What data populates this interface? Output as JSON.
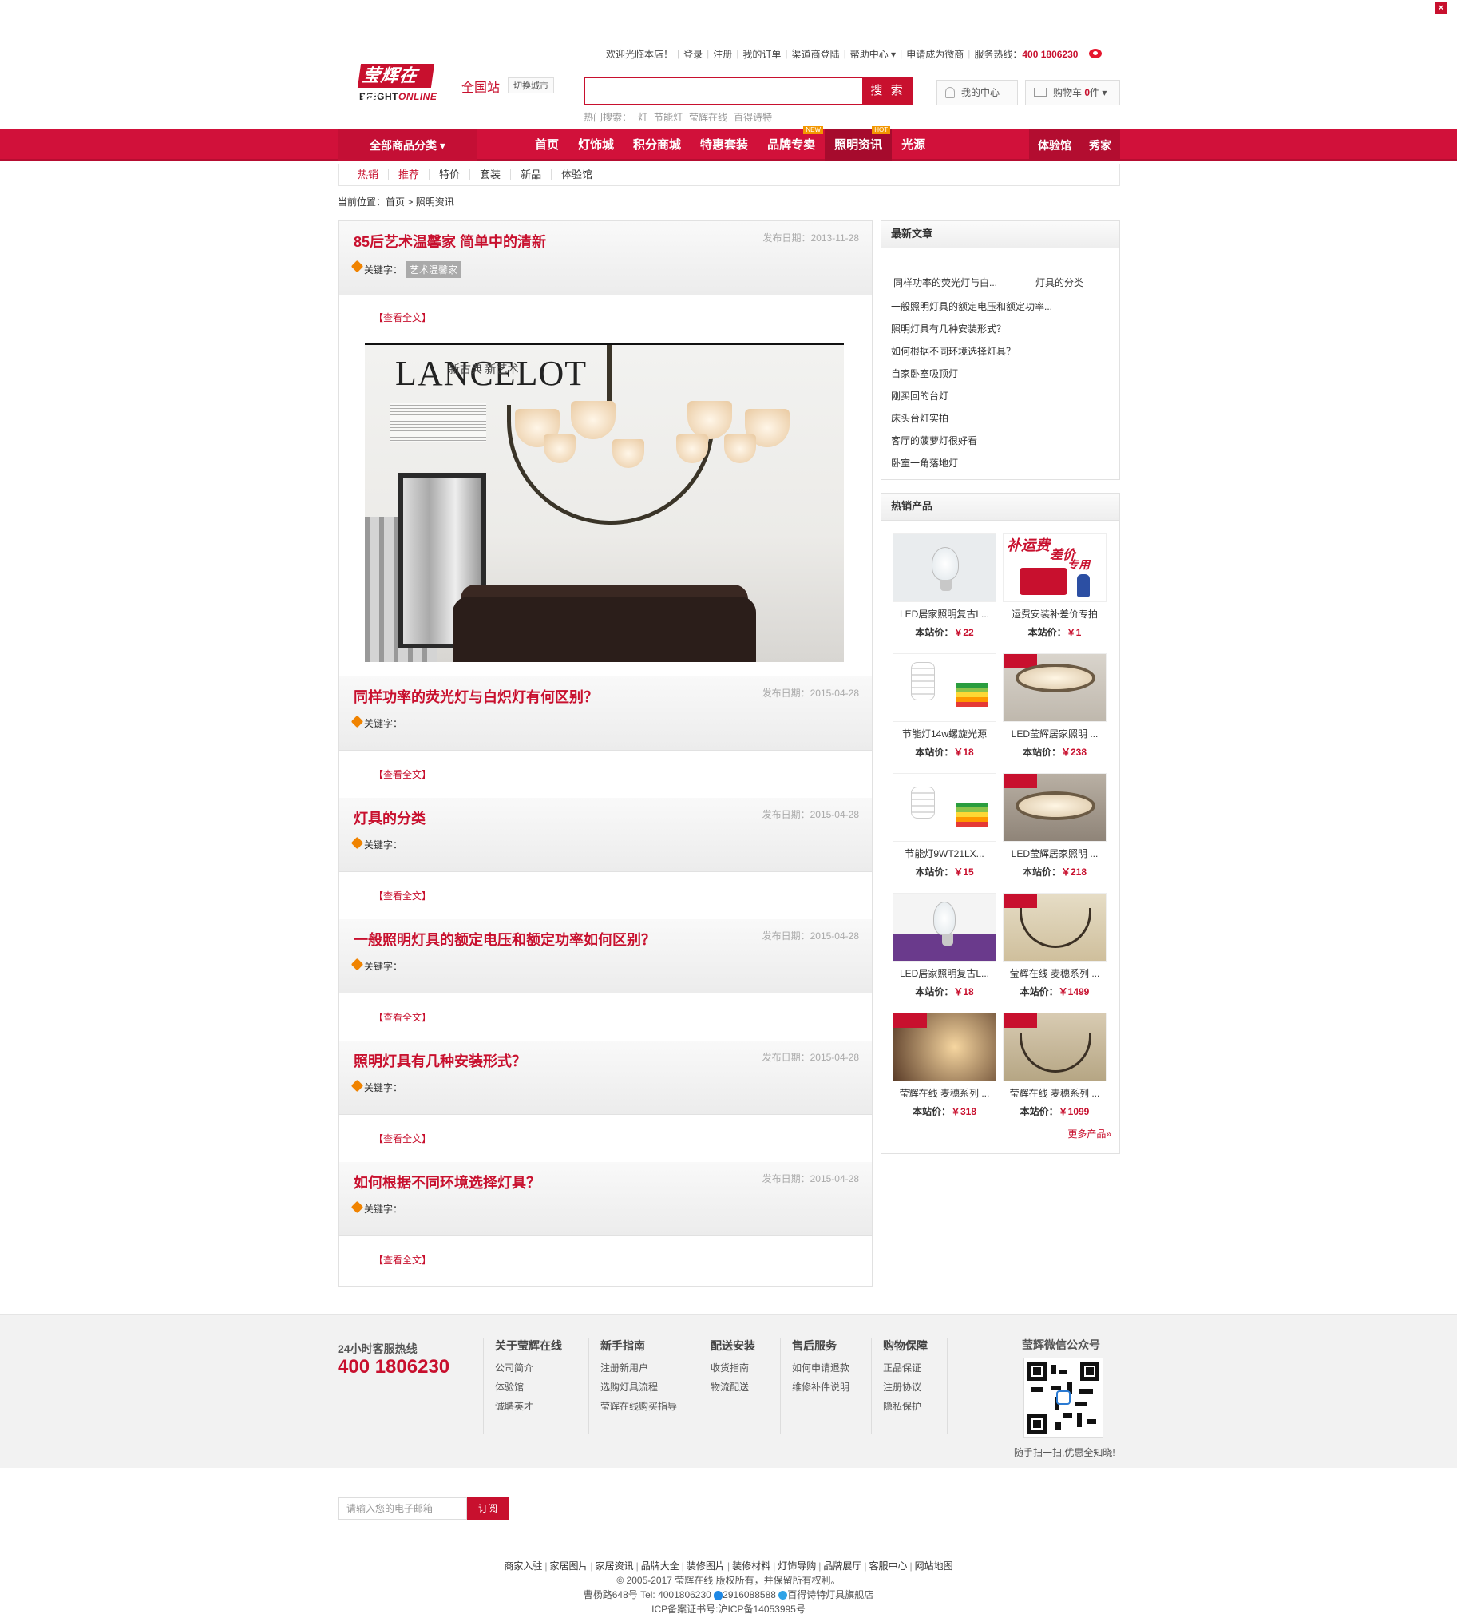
{
  "topbar": {
    "close": "×",
    "welcome": "欢迎光临本店！",
    "login": "登录",
    "register": "注册",
    "orders": "我的订单",
    "dealer": "渠道商登陆",
    "help": "帮助中心",
    "apply": "申请成为微商",
    "hotline_label": "服务热线：",
    "hotline": "400 1806230"
  },
  "logo": {
    "cn": "莹辉在线",
    "en_a": "BRIGHT",
    "en_b": "ONLINE"
  },
  "city": {
    "label": "全国站",
    "switch": "切换城市"
  },
  "search": {
    "button": "搜 索",
    "hot_label": "热门搜索：",
    "hot": [
      "灯",
      "节能灯",
      "莹辉在线",
      "百得诗特"
    ]
  },
  "user": {
    "center": "我的中心",
    "cart": "购物车",
    "cart_count": "0",
    "cart_unit": "件"
  },
  "nav": {
    "all": "全部商品分类",
    "items": [
      {
        "label": "首页",
        "badge": ""
      },
      {
        "label": "灯饰城",
        "badge": ""
      },
      {
        "label": "积分商城",
        "badge": ""
      },
      {
        "label": "特惠套装",
        "badge": ""
      },
      {
        "label": "品牌专卖",
        "badge": "NEW"
      },
      {
        "label": "照明资讯",
        "badge": "HOT"
      },
      {
        "label": "光源",
        "badge": ""
      }
    ],
    "right": [
      "体验馆",
      "秀家"
    ]
  },
  "subnav": [
    "热销",
    "推荐",
    "特价",
    "套装",
    "新品",
    "体验馆"
  ],
  "breadcrumb": {
    "label": "当前位置：",
    "home": "首页",
    "sep": ">",
    "current": "照明资讯"
  },
  "articles": [
    {
      "title": "85后艺术温馨家 简单中的清新",
      "date": "发布日期：2013-11-28",
      "kw_label": "关键字：",
      "keyword": "艺术温馨家",
      "more": "【查看全文】"
    },
    {
      "title": "同样功率的荧光灯与白炽灯有何区别？",
      "date": "发布日期：2015-04-28",
      "kw_label": "关键字：",
      "keyword": "",
      "more": "【查看全文】"
    },
    {
      "title": "灯具的分类",
      "date": "发布日期：2015-04-28",
      "kw_label": "关键字：",
      "keyword": "",
      "more": "【查看全文】"
    },
    {
      "title": "一般照明灯具的额定电压和额定功率如何区别？",
      "date": "发布日期：2015-04-28",
      "kw_label": "关键字：",
      "keyword": "",
      "more": "【查看全文】"
    },
    {
      "title": "照明灯具有几种安装形式？",
      "date": "发布日期：2015-04-28",
      "kw_label": "关键字：",
      "keyword": "",
      "more": "【查看全文】"
    },
    {
      "title": "如何根据不同环境选择灯具？",
      "date": "发布日期：2015-04-28",
      "kw_label": "关键字：",
      "keyword": "",
      "more": "【查看全文】"
    }
  ],
  "picture": {
    "brand": "LANCELOT",
    "tagline": "新古典 新艺术"
  },
  "latest": {
    "title": "最新文章",
    "items": [
      "同样功率的荧光灯与白...",
      "灯具的分类",
      "一般照明灯具的额定电压和额定功率...",
      "照明灯具有几种安装形式？",
      "如何根据不同环境选择灯具？",
      "自家卧室吸顶灯",
      "刚买回的台灯",
      "床头台灯实拍",
      "客厅的菠萝灯很好看",
      "卧室一角落地灯"
    ]
  },
  "hot": {
    "title": "热销产品",
    "price_label": "本站价：",
    "more": "更多产品»",
    "items": [
      {
        "name": "LED居家照明复古L...",
        "price": "￥22"
      },
      {
        "name": "运费安装补差价专拍",
        "price": "￥1"
      },
      {
        "name": "节能灯14w螺旋光源",
        "price": "￥18"
      },
      {
        "name": "LED莹辉居家照明 ...",
        "price": "￥238"
      },
      {
        "name": "节能灯9WT21LX...",
        "price": "￥15"
      },
      {
        "name": "LED莹辉居家照明 ...",
        "price": "￥218"
      },
      {
        "name": "LED居家照明复古L...",
        "price": "￥18"
      },
      {
        "name": "莹辉在线 麦穗系列 ...",
        "price": "￥1499"
      },
      {
        "name": "莹辉在线 麦穗系列 ...",
        "price": "￥318"
      },
      {
        "name": "莹辉在线 麦穗系列 ...",
        "price": "￥1099"
      }
    ],
    "img_text": {
      "promo_a": "补运费",
      "promo_b": "差价",
      "promo_c": "专用"
    }
  },
  "footer": {
    "hotline_title": "24小时客服热线",
    "hotline": "400 1806230",
    "cols": [
      {
        "title": "关于莹辉在线",
        "links": [
          "公司简介",
          "体验馆",
          "诚聘英才"
        ]
      },
      {
        "title": "新手指南",
        "links": [
          "注册新用户",
          "选购灯具流程",
          "莹辉在线购买指导"
        ]
      },
      {
        "title": "配送安装",
        "links": [
          "收货指南",
          "物流配送"
        ]
      },
      {
        "title": "售后服务",
        "links": [
          "如何申请退款",
          "维修补件说明"
        ]
      },
      {
        "title": "购物保障",
        "links": [
          "正品保证",
          "注册协议",
          "隐私保护"
        ]
      }
    ],
    "wechat_title": "莹辉微信公众号",
    "wechat_sub": "随手扫一扫,优惠全知晓!",
    "email_placeholder": "请输入您的电子邮箱",
    "subscribe": "订阅",
    "links": [
      "商家入驻",
      "家居图片",
      "家居资讯",
      "品牌大全",
      "装修图片",
      "装修材料",
      "灯饰导购",
      "品牌展厅",
      "客服中心",
      "网站地图"
    ],
    "copyright": "© 2005-2017 莹辉在线 版权所有，并保留所有权利。",
    "address": "曹杨路648号 Tel: 4001806230",
    "qq": "2916088588",
    "shop": "百得诗特灯具旗舰店",
    "icp": "ICP备案证书号:沪ICP备14053995号"
  }
}
